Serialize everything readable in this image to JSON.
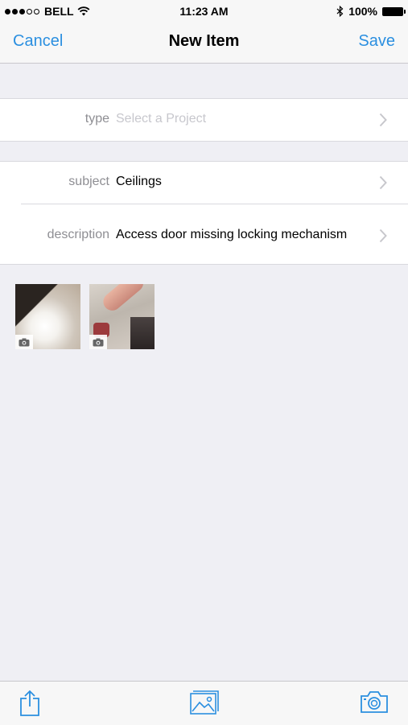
{
  "status_bar": {
    "carrier": "BELL",
    "time": "11:23 AM",
    "battery": "100%",
    "icons": [
      "signal-dots",
      "wifi-icon",
      "bluetooth-icon",
      "battery-icon"
    ]
  },
  "nav": {
    "cancel_label": "Cancel",
    "title": "New Item",
    "save_label": "Save"
  },
  "form": {
    "type": {
      "label": "type",
      "placeholder": "Select a Project"
    },
    "subject": {
      "label": "subject",
      "value": "Ceilings"
    },
    "description": {
      "label": "description",
      "value": "Access door missing locking mechanism"
    }
  },
  "photos": [
    {
      "badge_icon": "camera-icon"
    },
    {
      "badge_icon": "camera-icon"
    }
  ],
  "toolbar": {
    "icons": [
      "share-icon",
      "photo-library-icon",
      "camera-icon"
    ]
  },
  "colors": {
    "accent": "#2b8fe0",
    "background": "#efeff4",
    "label_gray": "#8e8e93",
    "placeholder_gray": "#c7c7cd"
  }
}
